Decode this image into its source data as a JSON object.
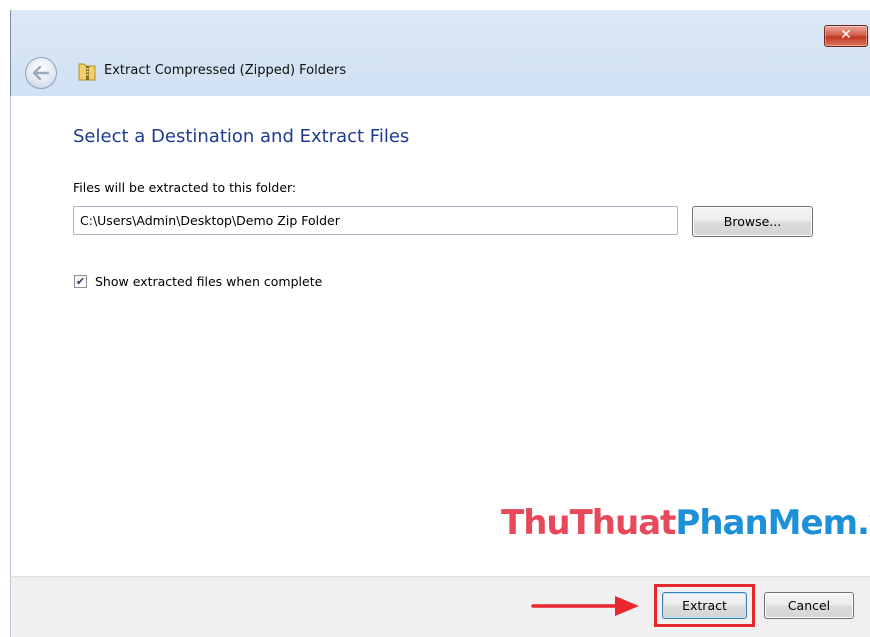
{
  "window": {
    "title": "Extract Compressed (Zipped) Folders",
    "close_symbol": "✕"
  },
  "icons": {
    "back": "back-arrow-icon",
    "zip_folder": "zip-folder-icon",
    "close": "close-icon",
    "checkmark": "checkmark-icon"
  },
  "content": {
    "heading": "Select a Destination and Extract Files",
    "destination_label": "Files will be extracted to this folder:",
    "destination_path": "C:\\Users\\Admin\\Desktop\\Demo Zip Folder",
    "browse_label": "Browse...",
    "show_files_checkbox": {
      "label": "Show extracted files when complete",
      "checked": true,
      "check_glyph": "✔"
    }
  },
  "watermark": {
    "part1": "ThuThuat",
    "part2": "PhanMem",
    "part3": ".vn",
    "color1": "#e8495a",
    "color2": "#1e90d8"
  },
  "footer": {
    "extract_label": "Extract",
    "cancel_label": "Cancel"
  },
  "colors": {
    "heading": "#1e3b8f",
    "highlight": "#e8262e",
    "annotation_arrow": "#e8262e"
  }
}
